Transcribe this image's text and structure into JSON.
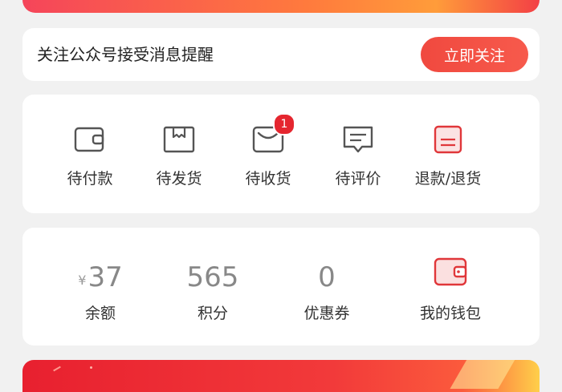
{
  "follow": {
    "text": "关注公众号接受消息提醒",
    "button_label": "立即关注"
  },
  "orders": {
    "items": [
      {
        "label": "待付款",
        "icon": "wallet-outline-icon"
      },
      {
        "label": "待发货",
        "icon": "package-box-icon"
      },
      {
        "label": "待收货",
        "icon": "inbox-tray-icon",
        "badge": "1"
      },
      {
        "label": "待评价",
        "icon": "comment-bubble-icon"
      },
      {
        "label": "退款/退货",
        "icon": "refund-document-icon"
      }
    ]
  },
  "assets": {
    "items": [
      {
        "currency": "¥",
        "value": "37",
        "label": "余额"
      },
      {
        "value": "565",
        "label": "积分"
      },
      {
        "value": "0",
        "label": "优惠券"
      },
      {
        "label": "我的钱包",
        "icon": "wallet-icon"
      }
    ]
  },
  "colors": {
    "accent_red": "#f0493f",
    "badge_red": "#e5262f",
    "icon_gray": "#555555",
    "refund_icon_red": "#e0373a"
  }
}
